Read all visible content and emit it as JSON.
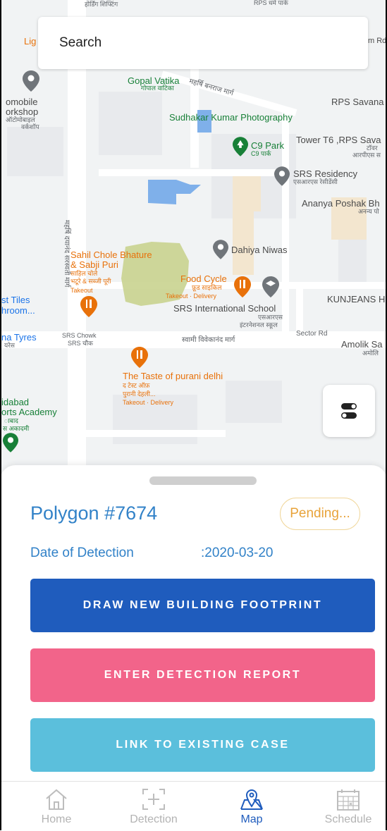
{
  "search": {
    "placeholder": "Search"
  },
  "map": {
    "labels": {
      "hoarding_top": "होर्डिंग शिफ्टिंग",
      "rps_top": "RPS धर्म पार्क",
      "lig": "Lig",
      "m_rd": "m Rd",
      "gopal_vatika": "Gopal Vatika",
      "gopal_vatika_hi": "गोपाल वाटिका",
      "banraj_marg": "महर्षि बनराज मार्ग",
      "automobile": "omobile",
      "workshop": "orkshop",
      "auto_hi": "ऑटोमोबाइल",
      "workshop_hi": "वर्कशॉप",
      "rps_savana": "RPS Savana",
      "sudhakar": "Sudhakar Kumar Photography",
      "tower_t6": "Tower T6 ,RPS Sava",
      "tower_hi": "टॉवर",
      "rps_hi": "आरपीएस स",
      "c9_park": "C9 Park",
      "c9_park_hi": "C9 पार्क",
      "srs_residency": "SRS Residency",
      "srs_residency_hi": "एसआरएस रेसीडेंसी",
      "ananya": "Ananya Poshak Bh",
      "ananya_hi": "अनन्य पो",
      "dayanand_road": "महर्षि दयानंद सरस्वती मार्ग",
      "dahiya_niwas": "Dahiya Niwas",
      "sahil_chole_1": "Sahil Chole Bhature",
      "sahil_chole_2": "& Sabji Puri",
      "sahil_hi_1": "साहिल चोले",
      "sahil_hi_2": "भटूरे & सब्जी पूरी",
      "sahil_takeout": "Takeout",
      "food_cycle": "Food Cycle",
      "food_cycle_hi": "फ़ूड साइकिल",
      "food_cycle_sub": "Takeout · Delivery",
      "kunjeans": "KUNJEANS H",
      "st_tiles": "st Tiles",
      "hroom": "hroom...",
      "srs_school": "SRS International School",
      "srs_school_hi_1": "एसआरएस",
      "srs_school_hi_2": "इंटरनेशनल स्कूल",
      "na_tyres": "na Tyres",
      "na_tyres_hi": "यरेस",
      "srs_chowk": "SRS Chowk",
      "srs_chowk_hi": "SRS चौक",
      "vivekanand_marg": "स्वामी विवेकानंद मार्ग",
      "sector_rd": "Sector Rd",
      "amolik": "Amolik Sa",
      "amolik_hi": "अमोलि",
      "taste_purani": "The Taste of purani delhi",
      "taste_hi_1": "द टेस्ट ऑफ़",
      "taste_hi_2": "पुरानी देहली...",
      "taste_sub": "Takeout · Delivery",
      "idabad": "idabad",
      "orts_academy": "orts Academy",
      "bad_hi": "ाबाद",
      "academy_hi": "स अकादमी"
    }
  },
  "detail": {
    "polygon_title": "Polygon #7674",
    "status": "Pending...",
    "date_label": "Date of Detection",
    "date_value": ":2020-03-20",
    "buttons": {
      "draw": "DRAW NEW BUILDING FOOTPRINT",
      "report": "ENTER DETECTION REPORT",
      "link": "LINK TO EXISTING CASE"
    }
  },
  "tabs": [
    {
      "label": "Home",
      "icon": "home-icon"
    },
    {
      "label": "Detection",
      "icon": "detection-icon"
    },
    {
      "label": "Map",
      "icon": "map-icon"
    },
    {
      "label": "Schedule",
      "icon": "schedule-icon"
    }
  ],
  "colors": {
    "primary_blue": "#1f5cbd",
    "title_blue": "#3282c8",
    "report_pink": "#f2648a",
    "link_cyan": "#5bbfdc",
    "pending_amber": "#e8a33a",
    "polygon_blue": "#7fb0ea",
    "polygon_green": "#c9d38f"
  }
}
